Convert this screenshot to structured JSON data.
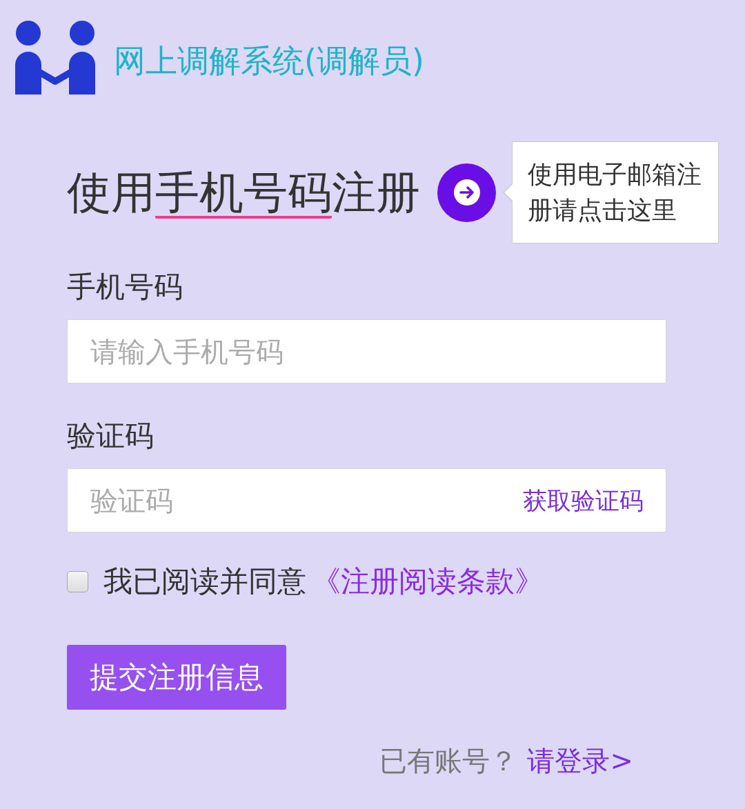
{
  "header": {
    "title": "网上调解系统(调解员)"
  },
  "form": {
    "heading": {
      "before": "使用",
      "underlined": "手机号码",
      "after": "注册"
    },
    "switch_tooltip": "使用电子邮箱注册请点击这里",
    "fields": [
      {
        "label": "手机号码",
        "placeholder": "请输入手机号码"
      },
      {
        "label": "验证码",
        "placeholder": "验证码",
        "action": "获取验证码"
      }
    ],
    "agreement": {
      "checked": false,
      "text": "我已阅读并同意",
      "link": "《注册阅读条款》"
    },
    "submit": "提交注册信息"
  },
  "footer": {
    "prompt": "已有账号？",
    "link": "请登录>"
  }
}
